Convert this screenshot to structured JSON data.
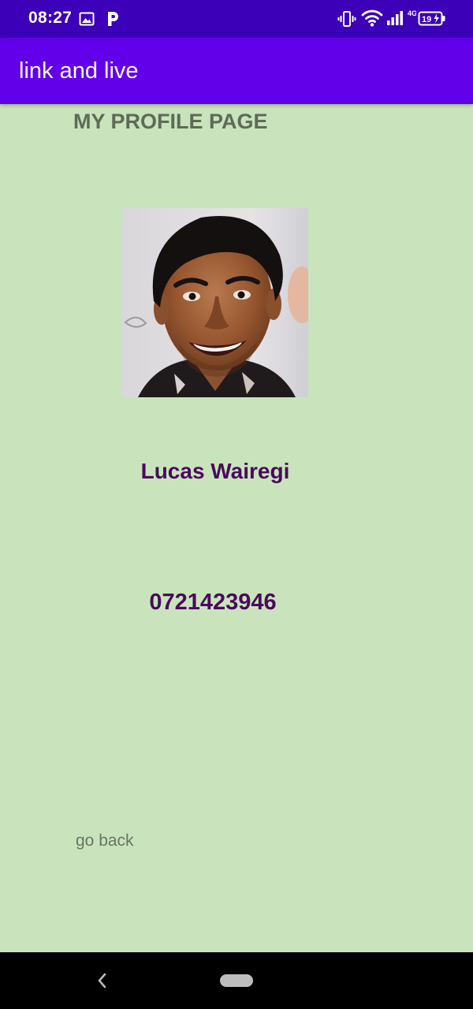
{
  "status_bar": {
    "time": "08:27",
    "left_icons": [
      "image-icon",
      "p-notification-icon"
    ],
    "right_icons": [
      "vibrate-icon",
      "wifi-icon",
      "signal-icon",
      "battery-icon"
    ],
    "network_type": "4G",
    "battery_level": "19"
  },
  "app_bar": {
    "title": "link and live"
  },
  "profile": {
    "heading": "MY PROFILE PAGE",
    "photo": "profile-photo",
    "name": "Lucas Wairegi",
    "phone": "0721423946",
    "back_link": "go back"
  },
  "nav_bar": {
    "icons": [
      "back-icon",
      "home-pill-icon"
    ]
  },
  "colors": {
    "status_bar": "#3b00b8",
    "app_bar": "#6200ea",
    "background": "#c9e4bd",
    "heading_text": "#5e6b57",
    "profile_text": "#4a0a5a",
    "link_text": "#6a7464"
  }
}
